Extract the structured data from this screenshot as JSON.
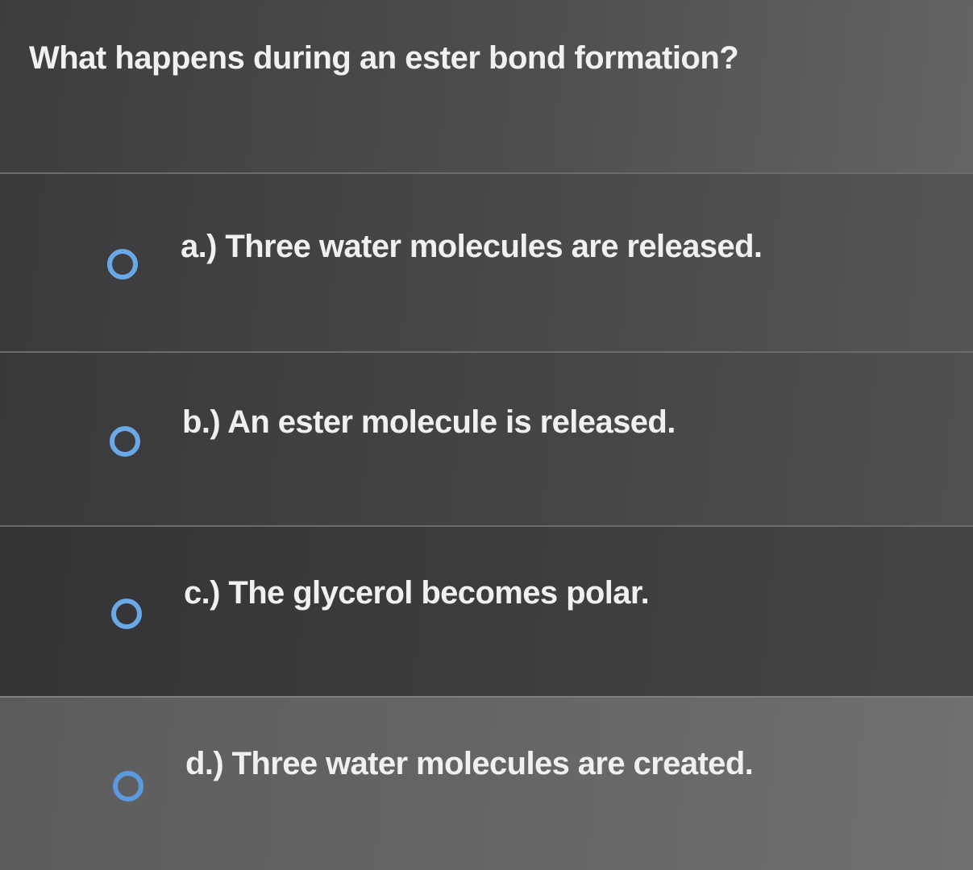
{
  "question": {
    "text": "What happens during an ester bond formation?"
  },
  "options": [
    {
      "letter": "a.)",
      "text": "a.) Three water molecules are released.",
      "selected": false
    },
    {
      "letter": "b.)",
      "text": "b.) An ester molecule is released.",
      "selected": false
    },
    {
      "letter": "c.)",
      "text": "c.) The glycerol becomes polar.",
      "selected": false
    },
    {
      "letter": "d.)",
      "text": "d.) Three water molecules are created.",
      "selected": false
    }
  ],
  "colors": {
    "radio_border": "#6aa8e8",
    "text": "#f0f0f0",
    "background": "#4a4a4c"
  },
  "icons": {
    "radio": "radio-unselected-icon"
  }
}
